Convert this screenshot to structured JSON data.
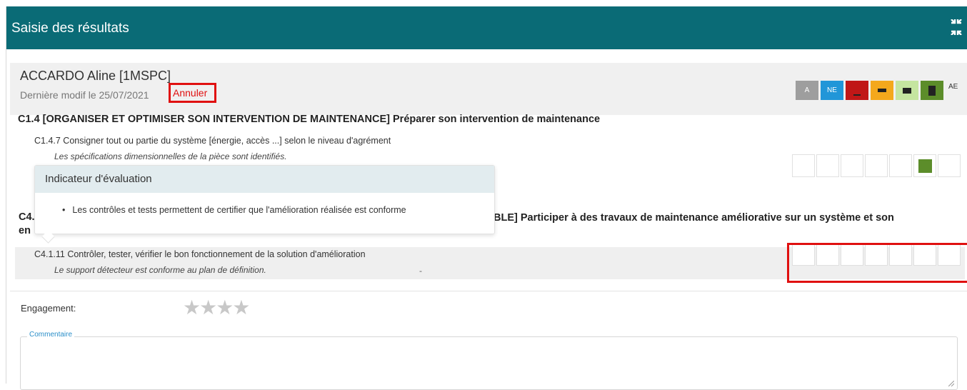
{
  "header": {
    "title": "Saisie des résultats",
    "collapse_icon": "collapse-arrows-icon"
  },
  "student": {
    "name": "ACCARDO Aline [1MSPC]",
    "last_modified": "Dernière modif le 25/07/2021",
    "cancel_label": "Annuler"
  },
  "legend": {
    "swatches": [
      {
        "label": "A",
        "color": "#9e9e9e",
        "mark": ""
      },
      {
        "label": "NE",
        "color": "#2196d8",
        "mark": ""
      },
      {
        "label": "",
        "color": "#c01717",
        "mark": "underline"
      },
      {
        "label": "",
        "color": "#f4a81c",
        "mark": "dash"
      },
      {
        "label": "",
        "color": "#c5e5a0",
        "mark": "block"
      },
      {
        "label": "",
        "color": "#5c8d2a",
        "mark": "tall-block"
      }
    ],
    "ae_label": "AE"
  },
  "competence_c14": {
    "title": "C1.4 [ORGANISER ET OPTIMISER SON INTERVENTION DE MAINTENANCE] Préparer son intervention de maintenance",
    "item": "C1.4.7 Consigner tout ou partie du système [énergie, accès ...] selon le niveau d'agrément",
    "indicator": "Les spécifications dimensionnelles de la pièce sont identifiés.",
    "selected_level": 6,
    "selected_color": "#5c8d2a"
  },
  "competence_c4": {
    "title_prefix": "C4.",
    "title_line2_prefix": "en",
    "title_visible": "BLE] Participer à des travaux de maintenance améliorative sur un système et son",
    "item": "C4.1.11 Contrôler, tester, vérifier le bon fonctionnement de la solution d'amélioration",
    "indicator": "Le support détecteur est conforme au plan de définition.",
    "stray_mark": "-"
  },
  "popover": {
    "title": "Indicateur d'évaluation",
    "bullet": "•",
    "item": "Les contrôles et tests permettent de certifier que l'amélioration réalisée est conforme"
  },
  "engagement": {
    "label": "Engagement:",
    "stars": [
      "★",
      "★",
      "★",
      "★"
    ],
    "rating": 0
  },
  "comment": {
    "label": "Commentaire",
    "value": ""
  }
}
